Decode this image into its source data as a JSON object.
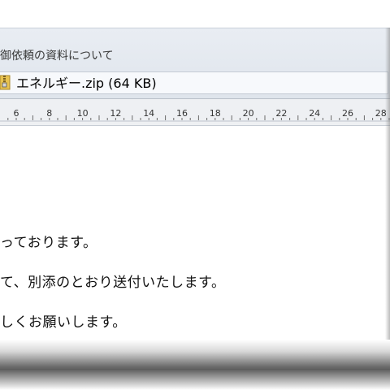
{
  "header": {
    "subject": "御依頼の資料について"
  },
  "attachment": {
    "icon": "zip-folder-icon",
    "label": "エネルギー.zip (64 KB)"
  },
  "ruler": {
    "ticks": [
      "6",
      "8",
      "10",
      "12",
      "14",
      "16",
      "18",
      "20",
      "22",
      "24",
      "26",
      "28"
    ]
  },
  "body": {
    "line1": "っております。",
    "line2": "て、別添のとおり送付いたします。",
    "line3": "しくお願いします。"
  }
}
